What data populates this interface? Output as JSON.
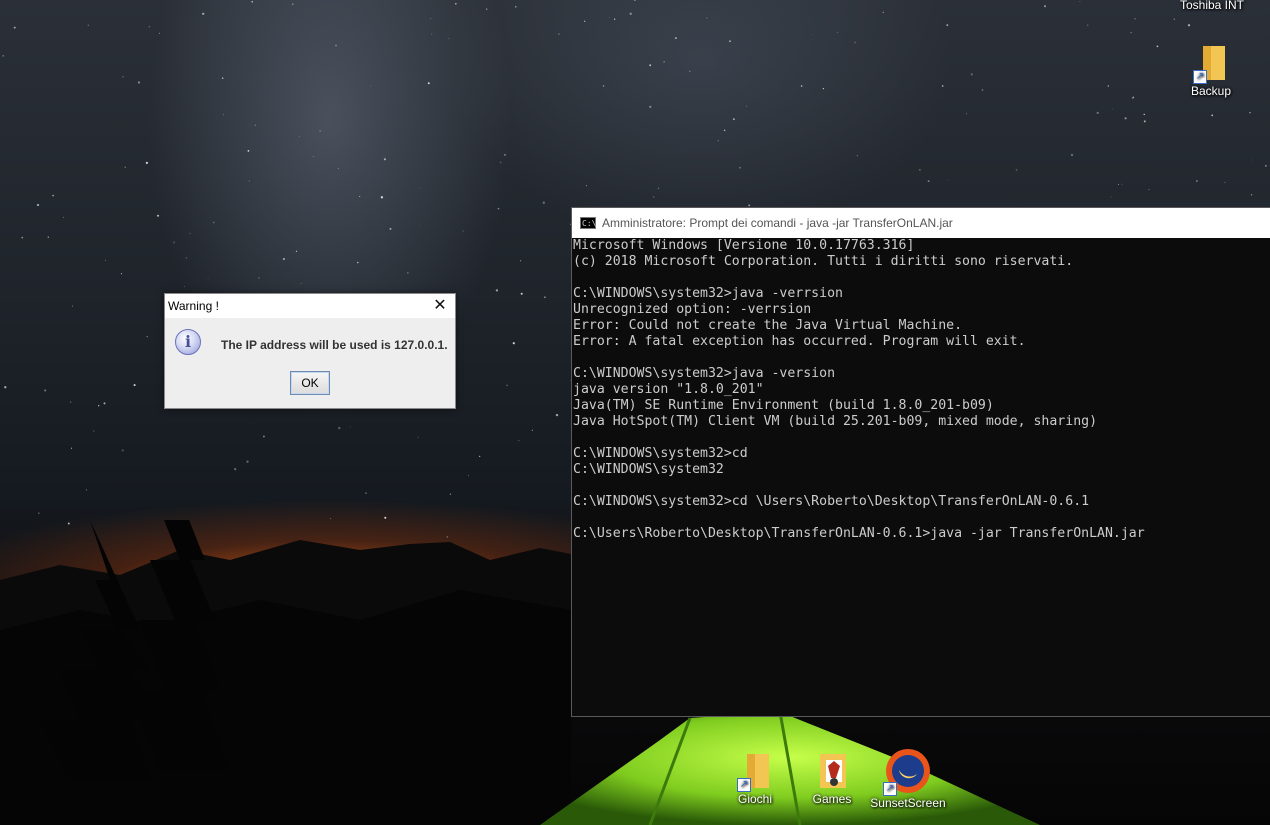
{
  "desktop": {
    "icons": [
      {
        "label": "Download\nToshiba INT",
        "name": "toshiba"
      },
      {
        "label": "Backup",
        "name": "backup"
      },
      {
        "label": "Giochi",
        "name": "giochi"
      },
      {
        "label": "Games",
        "name": "games"
      },
      {
        "label": "SunsetScreen",
        "name": "sunsetscreen"
      }
    ]
  },
  "cmd": {
    "title": "Amministratore: Prompt dei comandi - java  -jar TransferOnLAN.jar",
    "lines": [
      "Microsoft Windows [Versione 10.0.17763.316]",
      "(c) 2018 Microsoft Corporation. Tutti i diritti sono riservati.",
      "",
      "C:\\WINDOWS\\system32>java -verrsion",
      "Unrecognized option: -verrsion",
      "Error: Could not create the Java Virtual Machine.",
      "Error: A fatal exception has occurred. Program will exit.",
      "",
      "C:\\WINDOWS\\system32>java -version",
      "java version \"1.8.0_201\"",
      "Java(TM) SE Runtime Environment (build 1.8.0_201-b09)",
      "Java HotSpot(TM) Client VM (build 25.201-b09, mixed mode, sharing)",
      "",
      "C:\\WINDOWS\\system32>cd",
      "C:\\WINDOWS\\system32",
      "",
      "C:\\WINDOWS\\system32>cd \\Users\\Roberto\\Desktop\\TransferOnLAN-0.6.1",
      "",
      "C:\\Users\\Roberto\\Desktop\\TransferOnLAN-0.6.1>java -jar TransferOnLAN.jar"
    ]
  },
  "dialog": {
    "title": "Warning !",
    "message": "The IP address will be used is 127.0.0.1.",
    "ok_label": "OK",
    "close_glyph": "✕",
    "info_glyph": "i"
  }
}
